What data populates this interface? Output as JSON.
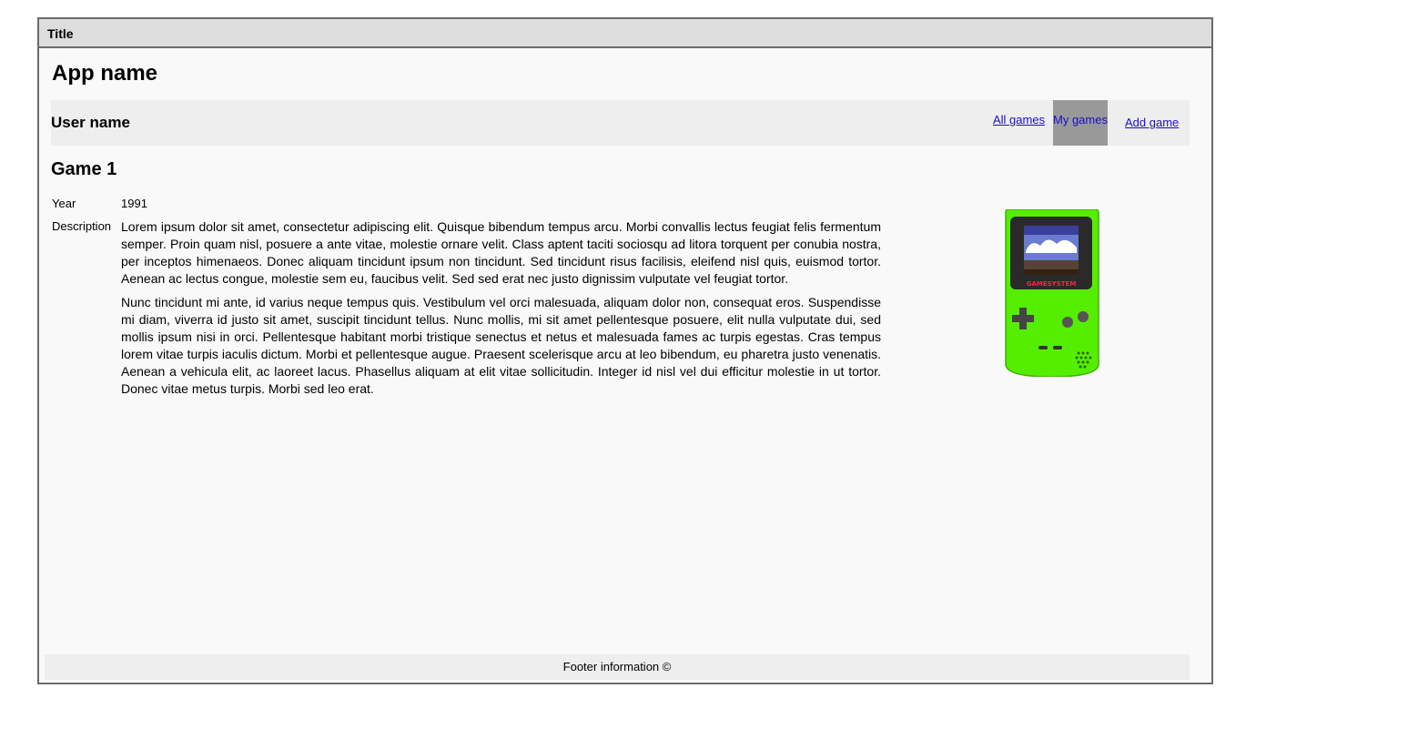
{
  "window": {
    "title": "Title"
  },
  "app": {
    "name": "App name"
  },
  "userbar": {
    "user_name": "User name",
    "nav": {
      "all_games": "All games",
      "my_games": "My games",
      "add_game": "Add game"
    }
  },
  "game": {
    "title": "Game 1",
    "year_label": "Year",
    "year": "1991",
    "description_label": "Description",
    "description": [
      "Lorem ipsum dolor sit amet, consectetur adipiscing elit. Quisque bibendum tempus arcu. Morbi convallis lectus feugiat felis fermentum semper. Proin quam nisl, posuere a ante vitae, molestie ornare velit. Class aptent taciti sociosqu ad litora torquent per conubia nostra, per inceptos himenaeos. Donec aliquam tincidunt ipsum non tincidunt. Sed tincidunt risus facilisis, eleifend nisl quis, euismod tortor. Aenean ac lectus congue, molestie sem eu, faucibus velit. Sed sed erat nec justo dignissim vulputate vel feugiat tortor.",
      "Nunc tincidunt mi ante, id varius neque tempus quis. Vestibulum vel orci malesuada, aliquam dolor non, consequat eros. Suspendisse mi diam, viverra id justo sit amet, suscipit tincidunt tellus. Nunc mollis, mi sit amet pellentesque posuere, elit nulla vulputate dui, sed mollis ipsum nisi in orci. Pellentesque habitant morbi tristique senectus et netus et malesuada fames ac turpis egestas. Cras tempus lorem vitae turpis iaculis dictum. Morbi et pellentesque augue. Praesent scelerisque arcu at leo bibendum, eu pharetra justo venenatis. Aenean a vehicula elit, ac laoreet lacus. Phasellus aliquam at elit vitae sollicitudin. Integer id nisl vel dui efficitur molestie in ut tortor. Donec vitae metus turpis. Morbi sed leo erat."
    ],
    "image": {
      "icon": "handheld-console-icon",
      "brand": "GAMESYSTEM",
      "body_color": "#55ee00"
    }
  },
  "footer": {
    "text": "Footer information ©"
  },
  "colors": {
    "window_border": "#6b6b6b",
    "titlebar": "#dddddd",
    "bar": "#eeeeee",
    "active_nav": "#999999",
    "link": "#1a0dcc"
  }
}
